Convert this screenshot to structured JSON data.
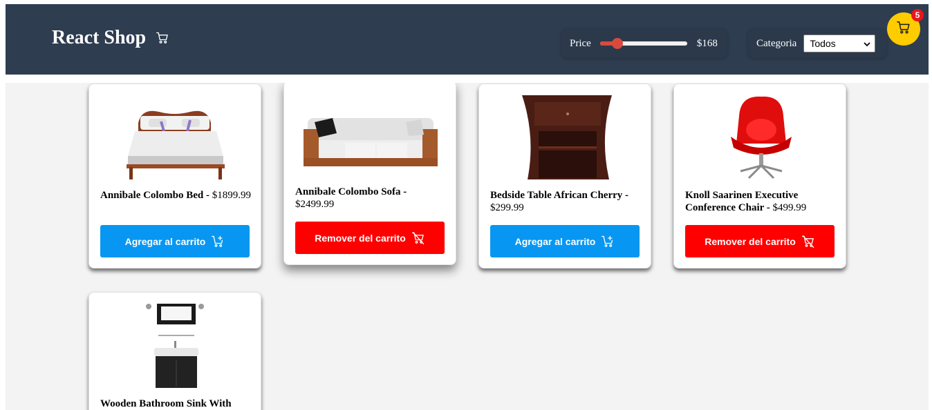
{
  "header": {
    "title": "React Shop",
    "cart_icon": "cart-icon",
    "background": "#2e3d50"
  },
  "filters": {
    "price_label": "Price",
    "price_value": "$168",
    "price_slider_fraction": 0.2,
    "slider_color": "#d94a3d",
    "category_label": "Categoria",
    "category_selected": "Todos"
  },
  "cart": {
    "count": "5",
    "button_color": "#ffcc00",
    "badge_color": "#e8161d"
  },
  "products": [
    {
      "name": "Annibale Colombo Bed",
      "separator": " -",
      "price": "$1899.99",
      "action": "Agregar al carrito",
      "in_cart": false,
      "image": "bed"
    },
    {
      "name": "Annibale Colombo Sofa",
      "separator": " -",
      "price": "$2499.99",
      "action": "Remover del carrito",
      "in_cart": true,
      "image": "sofa"
    },
    {
      "name": "Bedside Table African Cherry",
      "separator": " -",
      "price": "$299.99",
      "action": "Agregar al carrito",
      "in_cart": false,
      "image": "bedside-table"
    },
    {
      "name": "Knoll Saarinen Executive Conference Chair",
      "separator": " -",
      "price": "$499.99",
      "action": "Remover del carrito",
      "in_cart": true,
      "image": "chair"
    },
    {
      "name": "Wooden Bathroom Sink With",
      "separator": "",
      "price": "",
      "action": "",
      "in_cart": false,
      "image": "bathroom-sink"
    }
  ],
  "colors": {
    "add_button": "#0797f2",
    "remove_button": "#ff0000"
  }
}
